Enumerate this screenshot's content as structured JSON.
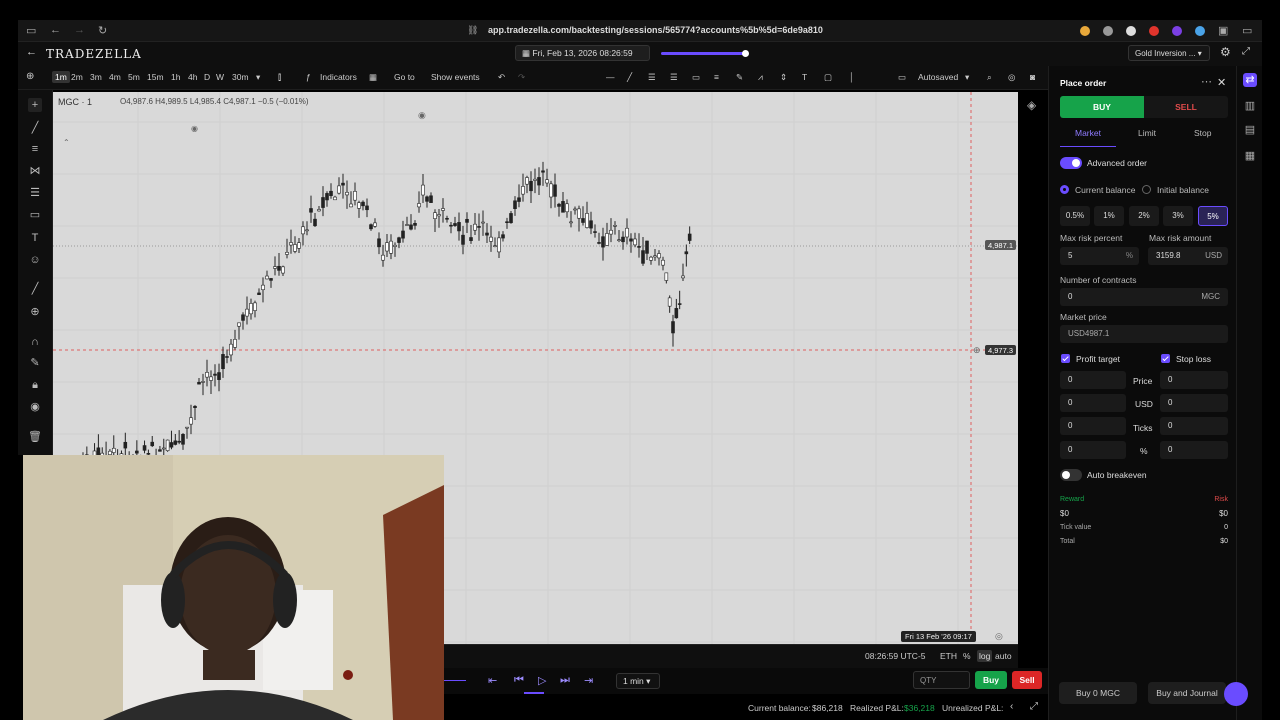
{
  "browser": {
    "url": "app.tradezella.com/backtesting/sessions/565774?accounts%5b%5d=6de9a810"
  },
  "app": {
    "logo": "TRADEZELLA",
    "session_date": "Fri, Feb 13, 2026 08:26:59",
    "session_name": "Gold Inversion ..."
  },
  "toolbar": {
    "timeframes": [
      "1m",
      "2m",
      "3m",
      "4m",
      "5m",
      "15m",
      "1h",
      "4h",
      "D",
      "W",
      "30m"
    ],
    "indicators": "Indicators",
    "goto": "Go to",
    "show_events": "Show events",
    "autosaved": "Autosaved"
  },
  "chart": {
    "symbol": "MGC · 1",
    "ohlc": "O4,987.6 H4,989.5 L4,985.4 C4,987.1 −0.5 (−0.01%)",
    "last_price_tag": "4,987.1",
    "line_price_tag": "4,977.3",
    "cursor_time": "Fri 13 Feb '26  09:17",
    "clock": "08:26:59 UTC-5",
    "session": "ETH",
    "scale_pct": "%",
    "scale_log": "log",
    "scale_auto": "auto"
  },
  "chart_data": {
    "type": "candlestick",
    "price_line": 4977.3,
    "last_price": 4987.1
  },
  "playback": {
    "timeframe": "1 min",
    "qty_placeholder": "QTY",
    "buy": "Buy",
    "sell": "Sell"
  },
  "status": {
    "current_balance_label": "Current balance:",
    "current_balance": "$86,218",
    "realized_label": "Realized P&L:",
    "realized": "$36,218",
    "unrealized_label": "Unrealized P&L:"
  },
  "order": {
    "title": "Place order",
    "buy": "BUY",
    "sell": "SELL",
    "tabs": [
      "Market",
      "Limit",
      "Stop"
    ],
    "advanced": "Advanced order",
    "current_balance": "Current balance",
    "initial_balance": "Initial balance",
    "risk_opts": [
      "0.5%",
      "1%",
      "2%",
      "3%",
      "5%"
    ],
    "max_risk_percent_label": "Max risk percent",
    "max_risk_percent": "5",
    "pct_unit": "%",
    "max_risk_amount_label": "Max risk amount",
    "max_risk_amount": "3159.8",
    "usd_unit": "USD",
    "contracts_label": "Number of contracts",
    "contracts": "0",
    "contracts_unit": "MGC",
    "market_price_label": "Market price",
    "market_price": "USD4987.1",
    "profit_target": "Profit target",
    "stop_loss": "Stop loss",
    "rows": [
      {
        "left": "0",
        "label": "Price",
        "right": "0"
      },
      {
        "left": "0",
        "label": "USD",
        "right": "0"
      },
      {
        "left": "0",
        "label": "Ticks",
        "right": "0"
      },
      {
        "left": "0",
        "label": "%",
        "right": "0"
      }
    ],
    "auto_breakeven": "Auto breakeven",
    "reward_label": "Reward",
    "risk_label": "Risk",
    "reward": "$0",
    "risk": "$0",
    "tick_value_label": "Tick value",
    "tick_value": "0",
    "total_label": "Total",
    "total": "$0",
    "buy_mgc": "Buy 0 MGC",
    "buy_journal": "Buy and Journal"
  },
  "colors": {
    "accent": "#6a4cff",
    "buy": "#16a34a",
    "sell": "#dc2626",
    "chart_bg": "#d9d9d9"
  }
}
